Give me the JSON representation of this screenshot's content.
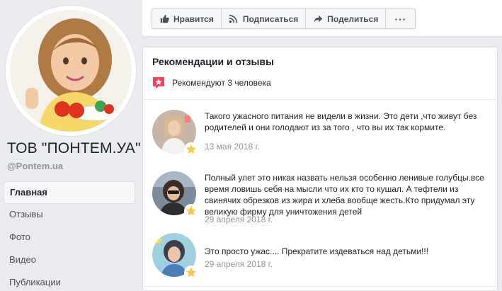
{
  "page": {
    "name": "ТОВ \"ПОНТЕМ.УА\"",
    "handle": "@Pontem.ua"
  },
  "nav": [
    {
      "label": "Главная",
      "active": true
    },
    {
      "label": "Отзывы",
      "active": false
    },
    {
      "label": "Фото",
      "active": false
    },
    {
      "label": "Видео",
      "active": false
    },
    {
      "label": "Публикации",
      "active": false
    }
  ],
  "actions": {
    "like_label": "Нравится",
    "follow_label": "Подписаться",
    "share_label": "Поделиться",
    "more_label": "···"
  },
  "recommendations": {
    "title": "Рекомендации и отзывы",
    "summary": "Рекомендуют 3 человека",
    "reviews": [
      {
        "text": "Такого ужасного питания не видели в жизни. Это дети ,что живут без родителей и они голодают из за того , что вы их так кормите.",
        "date": "13 мая 2018 г."
      },
      {
        "text": "Полный улет это никак назвать нельзя особенно ленивые голубцы.все время ловишь себя на мысли что их кто то кушал. А тефтели из свинячих обрезков из жира и хлеба вообще жесть.Кто придумал эту великую фирму для уничтожения детей",
        "date": "29 апреля 2018 г."
      },
      {
        "text": "Это просто ужас.... Прекратите издеваться над детьми!!!",
        "date": "29 апреля 2018 г."
      }
    ]
  },
  "colors": {
    "accent": "#4267b2",
    "badge_red": "#f3425f",
    "star": "#f7c948",
    "secondary_text": "#90949c"
  },
  "icons": {
    "like": "thumbs-up-icon",
    "follow": "rss-icon",
    "share": "share-arrow-icon",
    "more": "more-dots-icon",
    "recommend": "recommendation-badge-icon",
    "review_star": "star-icon"
  }
}
